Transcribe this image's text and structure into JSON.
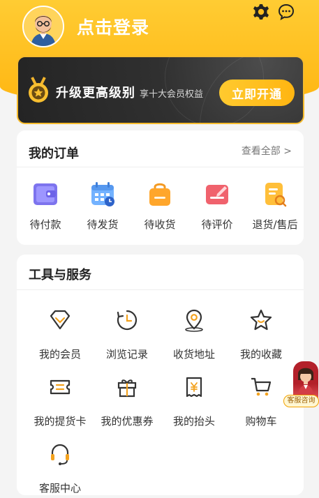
{
  "header": {
    "login_label": "点击登录",
    "icons": [
      "settings-icon",
      "message-icon"
    ],
    "avatar": "user-avatar-icon"
  },
  "vip": {
    "title": "升级更高级别",
    "subtitle": "享十大会员权益",
    "button_label": "立即开通"
  },
  "orders": {
    "title": "我的订单",
    "view_all": "查看全部 >",
    "items": [
      {
        "label": "待付款",
        "icon": "wallet-icon"
      },
      {
        "label": "待发货",
        "icon": "calendar-icon"
      },
      {
        "label": "待收货",
        "icon": "shopping-bag-icon"
      },
      {
        "label": "待评价",
        "icon": "edit-review-icon"
      },
      {
        "label": "退货/售后",
        "icon": "return-doc-icon"
      }
    ]
  },
  "tools": {
    "title": "工具与服务",
    "items": [
      {
        "label": "我的会员",
        "icon": "diamond-icon"
      },
      {
        "label": "浏览记录",
        "icon": "history-clock-icon"
      },
      {
        "label": "收货地址",
        "icon": "location-pin-icon"
      },
      {
        "label": "我的收藏",
        "icon": "star-icon"
      },
      {
        "label": "我的提货卡",
        "icon": "card-ticket-icon"
      },
      {
        "label": "我的优惠券",
        "icon": "gift-icon"
      },
      {
        "label": "我的抬头",
        "icon": "invoice-icon"
      },
      {
        "label": "购物车",
        "icon": "cart-icon"
      },
      {
        "label": "客服中心",
        "icon": "headset-icon"
      }
    ]
  },
  "support": {
    "label": "客服咨询",
    "icon": "customer-service-agent-icon"
  },
  "colors": {
    "brand_yellow": "#ffbf1f",
    "vip_dark": "#2b2b2b",
    "accent_orange": "#f3a21f"
  }
}
